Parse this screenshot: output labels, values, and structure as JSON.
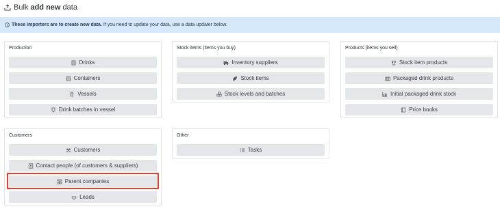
{
  "header": {
    "prefix": "Bulk ",
    "title_bold": "add new",
    "suffix": " data",
    "icon": "upload-tray-icon"
  },
  "banner": {
    "icon": "info-circle-icon",
    "strong_text": "These importers are to create new data.",
    "text": " If you need to update your data, use a data updater below."
  },
  "cards": {
    "production": {
      "title": "Production",
      "items": [
        {
          "label": "Drinks",
          "icon": "drinks-icon"
        },
        {
          "label": "Containers",
          "icon": "container-icon"
        },
        {
          "label": "Vessels",
          "icon": "vessel-icon"
        },
        {
          "label": "Drink batches in vessel",
          "icon": "batch-icon"
        }
      ]
    },
    "stock": {
      "title": "Stock items (items you buy)",
      "items": [
        {
          "label": "Inventory suppliers",
          "icon": "truck-icon"
        },
        {
          "label": "Stock items",
          "icon": "leaf-icon"
        },
        {
          "label": "Stock levels and batches",
          "icon": "boxes-icon"
        }
      ]
    },
    "products": {
      "title": "Products (items you sell)",
      "items": [
        {
          "label": "Stock item products",
          "icon": "shirt-icon"
        },
        {
          "label": "Packaged drink products",
          "icon": "crate-icon"
        },
        {
          "label": "Initial packaged drink stock",
          "icon": "chart-icon"
        },
        {
          "label": "Price books",
          "icon": "book-icon"
        }
      ]
    },
    "customers": {
      "title": "Customers",
      "items": [
        {
          "label": "Customers",
          "icon": "users-icon"
        },
        {
          "label": "Contact people (of customers & suppliers)",
          "icon": "contact-card-icon"
        },
        {
          "label": "Parent companies",
          "icon": "org-chart-icon"
        },
        {
          "label": "Leads",
          "icon": "handshake-icon"
        }
      ]
    },
    "other": {
      "title": "Other",
      "items": [
        {
          "label": "Tasks",
          "icon": "task-list-icon"
        }
      ]
    }
  },
  "colors": {
    "banner_bg": "#d6e8fb",
    "button_bg": "#e4e6e9",
    "highlight": "#e83a2b"
  }
}
